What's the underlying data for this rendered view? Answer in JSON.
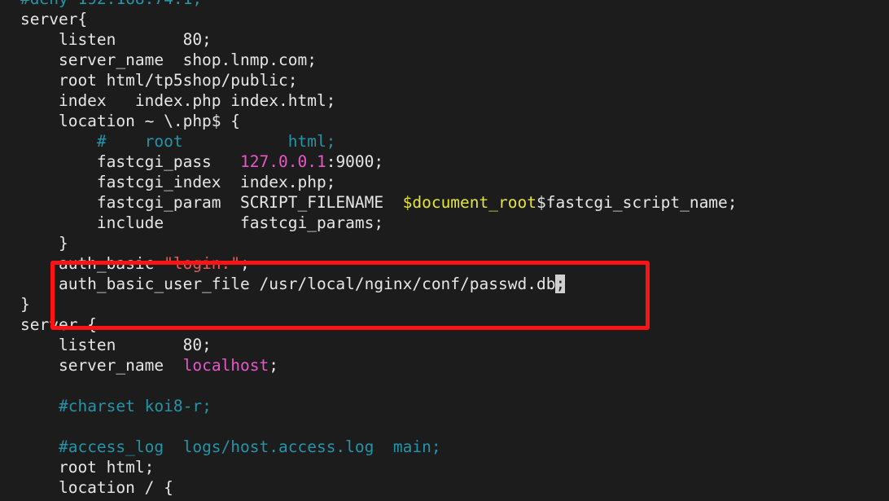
{
  "editor": {
    "background_color": "#1c1c1c",
    "foreground_color": "#e6e6e6",
    "comment_color": "#2494a8",
    "string_color": "#e35b5b",
    "number_color": "#e857c9",
    "variable_color": "#e4e43c",
    "cursor_color": "#cfcfcf",
    "highlight_box_color": "#fc1414"
  },
  "lines": [
    {
      "id": "l01",
      "parts": [
        {
          "t": "#deny 192.168.74.1;",
          "c": "cmt"
        }
      ]
    },
    {
      "id": "l02",
      "parts": [
        {
          "t": "server{",
          "c": "txt"
        }
      ]
    },
    {
      "id": "l03",
      "parts": [
        {
          "t": "    listen       80;",
          "c": "txt"
        }
      ]
    },
    {
      "id": "l04",
      "parts": [
        {
          "t": "    server_name  shop.lnmp.com;",
          "c": "txt"
        }
      ]
    },
    {
      "id": "l05",
      "parts": [
        {
          "t": "    root html/tp5shop/public;",
          "c": "txt"
        }
      ]
    },
    {
      "id": "l06",
      "parts": [
        {
          "t": "    index   index.php index.html;",
          "c": "txt"
        }
      ]
    },
    {
      "id": "l07",
      "parts": [
        {
          "t": "    location ~ \\.php$ {",
          "c": "txt"
        }
      ]
    },
    {
      "id": "l08",
      "parts": [
        {
          "t": "        ",
          "c": "txt"
        },
        {
          "t": "#    root           html;",
          "c": "cmt"
        }
      ]
    },
    {
      "id": "l09",
      "parts": [
        {
          "t": "        fastcgi_pass   ",
          "c": "txt"
        },
        {
          "t": "127.0.0.1",
          "c": "num"
        },
        {
          "t": ":9000;",
          "c": "txt"
        }
      ]
    },
    {
      "id": "l10",
      "parts": [
        {
          "t": "        fastcgi_index  index.php;",
          "c": "txt"
        }
      ]
    },
    {
      "id": "l11",
      "parts": [
        {
          "t": "        fastcgi_param  SCRIPT_FILENAME  ",
          "c": "txt"
        },
        {
          "t": "$document_root",
          "c": "var"
        },
        {
          "t": "$fastcgi_script_name;",
          "c": "txt"
        }
      ]
    },
    {
      "id": "l12",
      "parts": [
        {
          "t": "        include        fastcgi_params;",
          "c": "txt"
        }
      ]
    },
    {
      "id": "l13",
      "parts": [
        {
          "t": "    }",
          "c": "txt"
        }
      ]
    },
    {
      "id": "l14",
      "parts": [
        {
          "t": "    auth_basic ",
          "c": "txt"
        },
        {
          "t": "\"login:\"",
          "c": "str"
        },
        {
          "t": ";",
          "c": "txt"
        }
      ]
    },
    {
      "id": "l15",
      "parts": [
        {
          "t": "    auth_basic_user_file /usr/local/nginx/conf/passwd.db",
          "c": "txt"
        },
        {
          "t": ";",
          "c": "cursor"
        }
      ]
    },
    {
      "id": "l16",
      "parts": [
        {
          "t": "}",
          "c": "txt"
        }
      ]
    },
    {
      "id": "l17",
      "parts": [
        {
          "t": "server {",
          "c": "txt"
        }
      ]
    },
    {
      "id": "l18",
      "parts": [
        {
          "t": "    listen       80;",
          "c": "txt"
        }
      ]
    },
    {
      "id": "l19",
      "parts": [
        {
          "t": "    server_name  ",
          "c": "txt"
        },
        {
          "t": "localhost",
          "c": "num"
        },
        {
          "t": ";",
          "c": "txt"
        }
      ]
    },
    {
      "id": "l20",
      "parts": [
        {
          "t": "",
          "c": "txt"
        }
      ]
    },
    {
      "id": "l21",
      "parts": [
        {
          "t": "    ",
          "c": "txt"
        },
        {
          "t": "#charset koi8-r;",
          "c": "cmt"
        }
      ]
    },
    {
      "id": "l22",
      "parts": [
        {
          "t": "",
          "c": "txt"
        }
      ]
    },
    {
      "id": "l23",
      "parts": [
        {
          "t": "    ",
          "c": "txt"
        },
        {
          "t": "#access_log  logs/host.access.log  main;",
          "c": "cmt"
        }
      ]
    },
    {
      "id": "l24",
      "parts": [
        {
          "t": "    root html;",
          "c": "txt"
        }
      ]
    },
    {
      "id": "l25",
      "parts": [
        {
          "t": "    location / {",
          "c": "txt"
        }
      ]
    }
  ],
  "annotation": {
    "label": "auth-basic-block-highlight",
    "shape": "rectangle",
    "color": "#fc1414"
  }
}
